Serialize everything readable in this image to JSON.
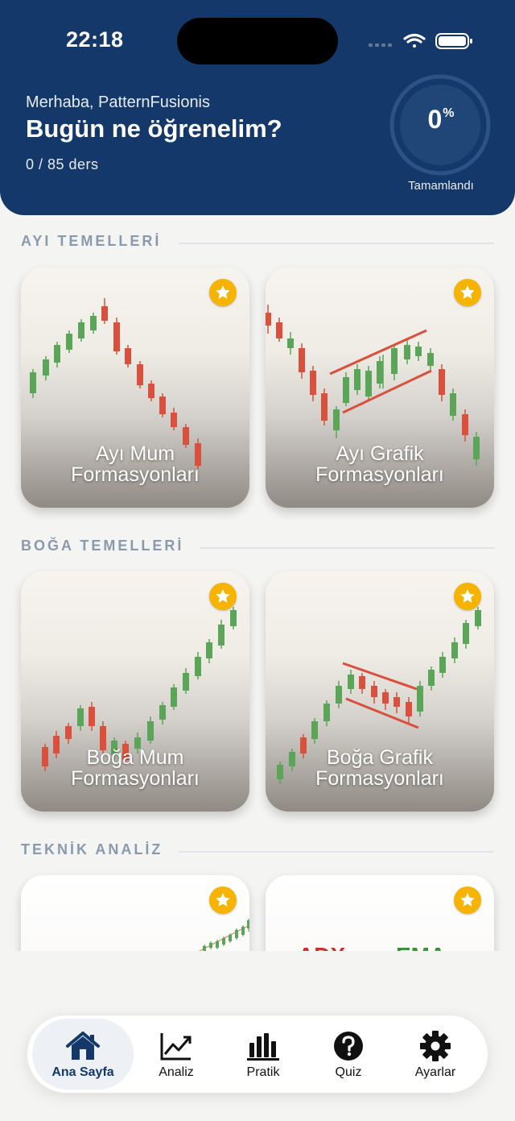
{
  "status": {
    "time": "22:18"
  },
  "header": {
    "greeting": "Merhaba, PatternFusionis",
    "title": "Bugün ne öğrenelim?",
    "progress": "0 / 85 ders",
    "percent_value": "0",
    "percent_sign": "%",
    "completed_label": "Tamamlandı"
  },
  "sections": [
    {
      "title": "AYI TEMELLERİ",
      "cards": [
        {
          "line1": "Ayı Mum",
          "line2": "Formasyonları"
        },
        {
          "line1": "Ayı Grafik",
          "line2": "Formasyonları"
        }
      ]
    },
    {
      "title": "BOĞA TEMELLERİ",
      "cards": [
        {
          "line1": "Boğa Mum",
          "line2": "Formasyonları"
        },
        {
          "line1": "Boğa Grafik",
          "line2": "Formasyonları"
        }
      ]
    },
    {
      "title": "TEKNİK ANALİZ",
      "cards": [
        {
          "line1": "",
          "line2": ""
        },
        {
          "word_left": "ADX",
          "word_right": "EMA"
        }
      ]
    }
  ],
  "tabs": [
    {
      "label": "Ana Sayfa",
      "icon": "home-icon",
      "active": true
    },
    {
      "label": "Analiz",
      "icon": "line-chart-icon"
    },
    {
      "label": "Pratik",
      "icon": "bar-chart-icon"
    },
    {
      "label": "Quiz",
      "icon": "question-icon"
    },
    {
      "label": "Ayarlar",
      "icon": "gear-icon"
    }
  ],
  "colors": {
    "header": "#14386a",
    "bull": "#5aa557",
    "bear": "#d9503c",
    "star": "#f6b400"
  }
}
